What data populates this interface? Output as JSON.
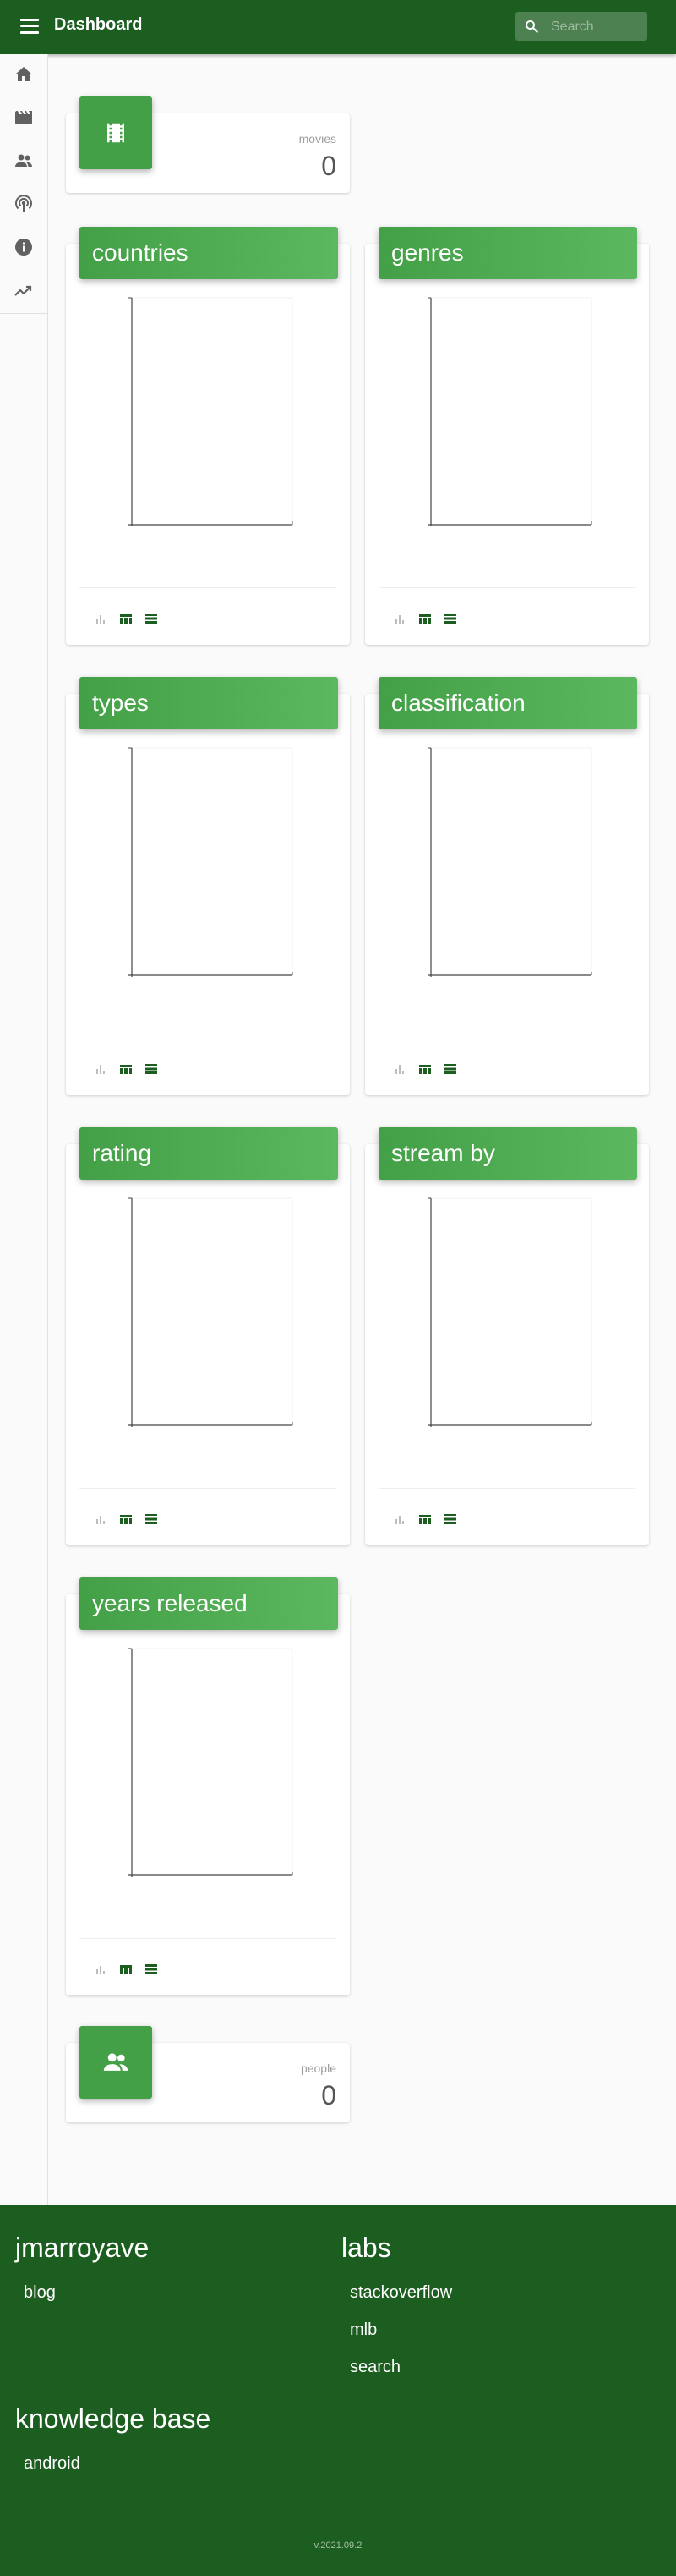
{
  "header": {
    "title": "Dashboard",
    "search_placeholder": "Search"
  },
  "sidebar": {
    "items": [
      {
        "icon": "home-icon"
      },
      {
        "icon": "movie-icon"
      },
      {
        "icon": "people-icon"
      },
      {
        "icon": "podcast-icon"
      },
      {
        "icon": "info-icon"
      },
      {
        "icon": "trending-icon"
      }
    ]
  },
  "stats": {
    "movies": {
      "label": "movies",
      "value": "0"
    },
    "people": {
      "label": "people",
      "value": "0"
    }
  },
  "charts": [
    {
      "title": "countries"
    },
    {
      "title": "genres"
    },
    {
      "title": "types"
    },
    {
      "title": "classification"
    },
    {
      "title": "rating"
    },
    {
      "title": "stream by"
    },
    {
      "title": "years released"
    }
  ],
  "chart_data": [
    {
      "type": "bar",
      "title": "countries",
      "categories": [],
      "values": []
    },
    {
      "type": "bar",
      "title": "genres",
      "categories": [],
      "values": []
    },
    {
      "type": "bar",
      "title": "types",
      "categories": [],
      "values": []
    },
    {
      "type": "bar",
      "title": "classification",
      "categories": [],
      "values": []
    },
    {
      "type": "bar",
      "title": "rating",
      "categories": [],
      "values": []
    },
    {
      "type": "bar",
      "title": "stream by",
      "categories": [],
      "values": []
    },
    {
      "type": "bar",
      "title": "years released",
      "categories": [],
      "values": []
    }
  ],
  "footer": {
    "sections": [
      {
        "title": "jmarroyave",
        "links": [
          "blog"
        ]
      },
      {
        "title": "labs",
        "links": [
          "stackoverflow",
          "mlb",
          "search"
        ]
      },
      {
        "title": "knowledge base",
        "links": [
          "android"
        ]
      }
    ],
    "version": "v.2021.09.2"
  },
  "colors": {
    "primary_dark": "#1b5e20",
    "primary": "#43a047",
    "primary_light": "#5cb85f",
    "background": "#fafafa"
  }
}
